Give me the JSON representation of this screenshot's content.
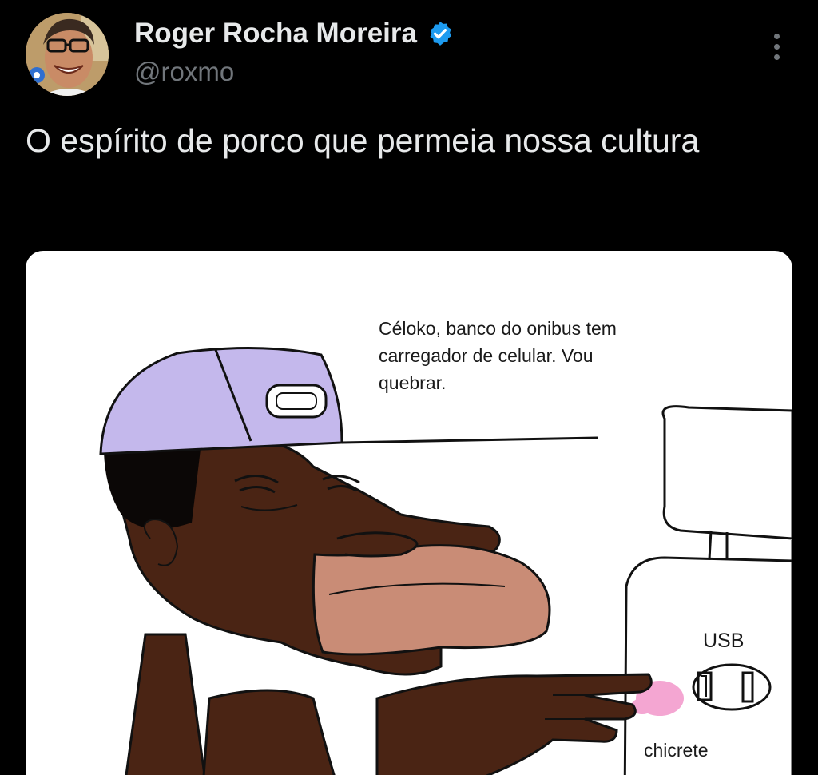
{
  "author": {
    "display_name": "Roger Rocha Moreira",
    "handle": "@roxmo",
    "verified_icon": "verified-badge-icon",
    "verified_color": "#1d9bf0"
  },
  "menu": {
    "icon": "more-options-icon"
  },
  "tweet": {
    "text": "O espírito de porco que permeia nossa cultura"
  },
  "media": {
    "speech_bubble": "Céloko, banco do onibus tem carregador de celular. Vou quebrar.",
    "usb_label": "USB",
    "gum_label": "chicrete"
  },
  "colors": {
    "background": "#000000",
    "primary_text": "#e7e9ea",
    "secondary_text": "#71767b",
    "cap": "#c4b8ec",
    "skin": "#4a2414",
    "lips": "#c98c76",
    "gum": "#f4a6d2"
  }
}
